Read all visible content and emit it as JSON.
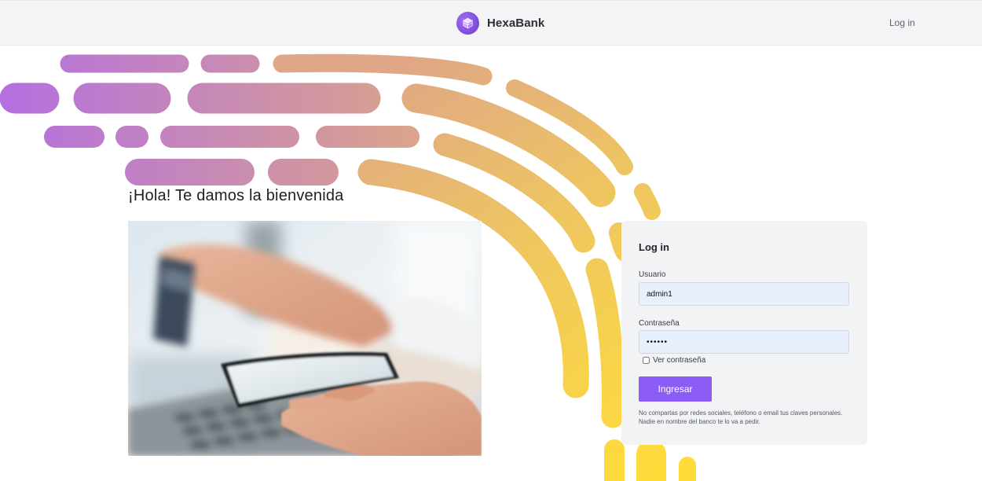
{
  "navbar": {
    "brand_name": "HexaBank",
    "login_link": "Log in"
  },
  "hero": {
    "title": "¡Hola! Te damos la bienvenida"
  },
  "login_card": {
    "title": "Log in",
    "username_label": "Usuario",
    "username_value": "admin1",
    "password_label": "Contraseña",
    "password_value": "••••••",
    "show_password_label": "Ver contraseña",
    "submit_label": "Ingresar",
    "disclaimer": "No compartas por redes sociales, teléfono o email tus claves personales. Nadie en nombre del banco te lo va a pedir."
  },
  "colors": {
    "accent": "#8b5cf6",
    "gradient_purple": "#b56fe0",
    "gradient_yellow": "#ffd93a",
    "navbar_bg": "#f3f4f6",
    "card_bg": "#f2f3f5",
    "input_bg": "#e8f0fe"
  },
  "icons": {
    "brand_logo": "cube-icon"
  }
}
